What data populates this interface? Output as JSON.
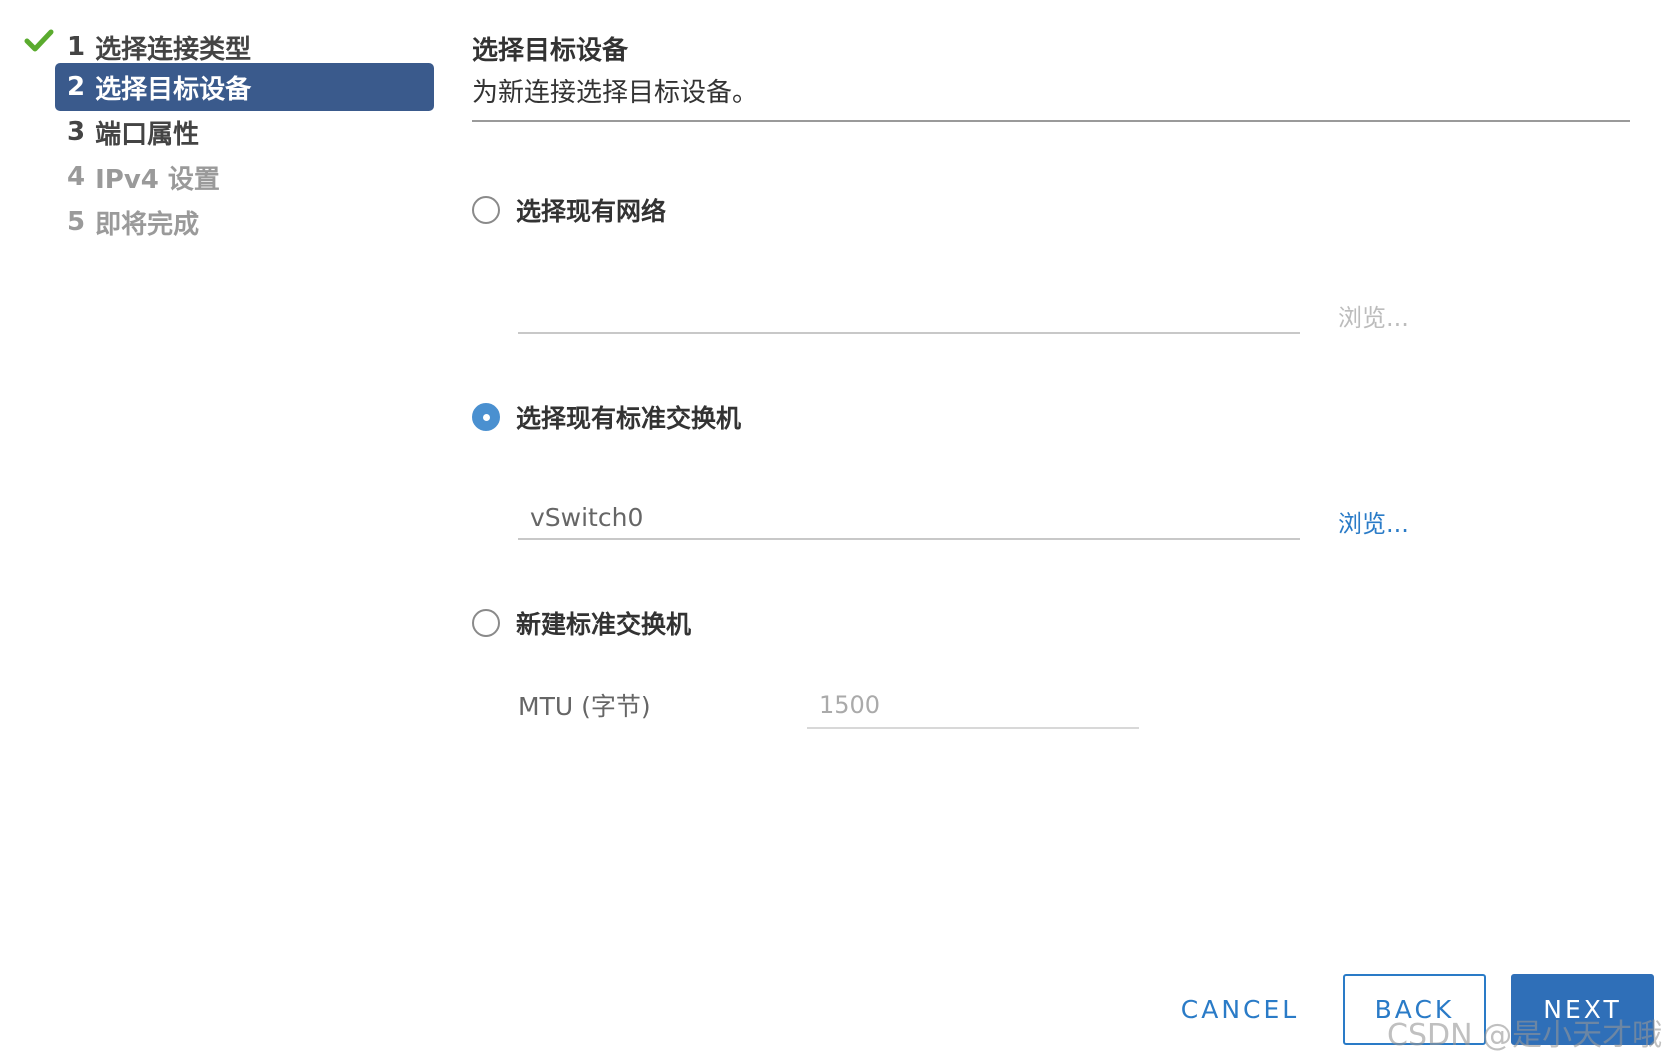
{
  "sidebar": {
    "steps": [
      {
        "num": "1",
        "label": "选择连接类型",
        "state": "done"
      },
      {
        "num": "2",
        "label": "选择目标设备",
        "state": "active"
      },
      {
        "num": "3",
        "label": "端口属性",
        "state": "pending"
      },
      {
        "num": "4",
        "label": "IPv4 设置",
        "state": "disabled"
      },
      {
        "num": "5",
        "label": "即将完成",
        "state": "disabled"
      }
    ],
    "check_icon": "checkmark-icon",
    "check_color": "#5aab2e"
  },
  "main": {
    "title": "选择目标设备",
    "subtitle": "为新连接选择目标设备。",
    "options": [
      {
        "label": "选择现有网络",
        "checked": false,
        "field_value": "",
        "browse_label": "浏览...",
        "browse_enabled": false
      },
      {
        "label": "选择现有标准交换机",
        "checked": true,
        "field_value": "vSwitch0",
        "browse_label": "浏览...",
        "browse_enabled": true
      },
      {
        "label": "新建标准交换机",
        "checked": false,
        "mtu_label": "MTU (字节)",
        "mtu_value": "1500"
      }
    ]
  },
  "footer": {
    "cancel_label": "CANCEL",
    "back_label": "BACK",
    "next_label": "NEXT"
  },
  "watermark": "CSDN @是小天才哦",
  "colors": {
    "active_step_bg": "#3a5a8c",
    "accent_blue": "#2a7bc7",
    "radio_checked": "#4a90d0",
    "next_button_bg": "#2f6fb8"
  }
}
